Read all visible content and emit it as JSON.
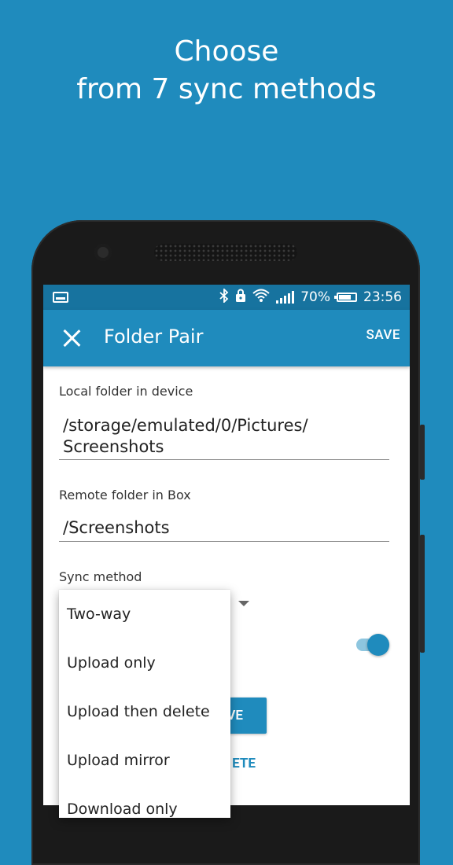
{
  "headline": {
    "line1": "Choose",
    "line2": "from 7 sync methods"
  },
  "statusbar": {
    "icons": [
      "screenshot-icon",
      "bluetooth-icon",
      "lock-icon",
      "wifi-icon",
      "signal-icon",
      "battery-icon"
    ],
    "battery_text": "70%",
    "time": "23:56"
  },
  "appbar": {
    "title": "Folder Pair",
    "save_label": "SAVE"
  },
  "form": {
    "local_label": "Local folder in device",
    "local_value_line1": "/storage/emulated/0/Pictures/",
    "local_value_line2": "Screenshots",
    "remote_label": "Remote folder in Box",
    "remote_value": "/Screenshots",
    "sync_label": "Sync method",
    "partial_save_button": "VE",
    "partial_delete_button": "ETE"
  },
  "dropdown": {
    "options": [
      "Two-way",
      "Upload only",
      "Upload then delete",
      "Upload mirror"
    ],
    "partial_last_option": "Download only"
  },
  "colors": {
    "background": "#1f8bbd",
    "status_bar": "#17739f",
    "app_bar": "#1f8bbd",
    "accent": "#1f8bbd"
  }
}
